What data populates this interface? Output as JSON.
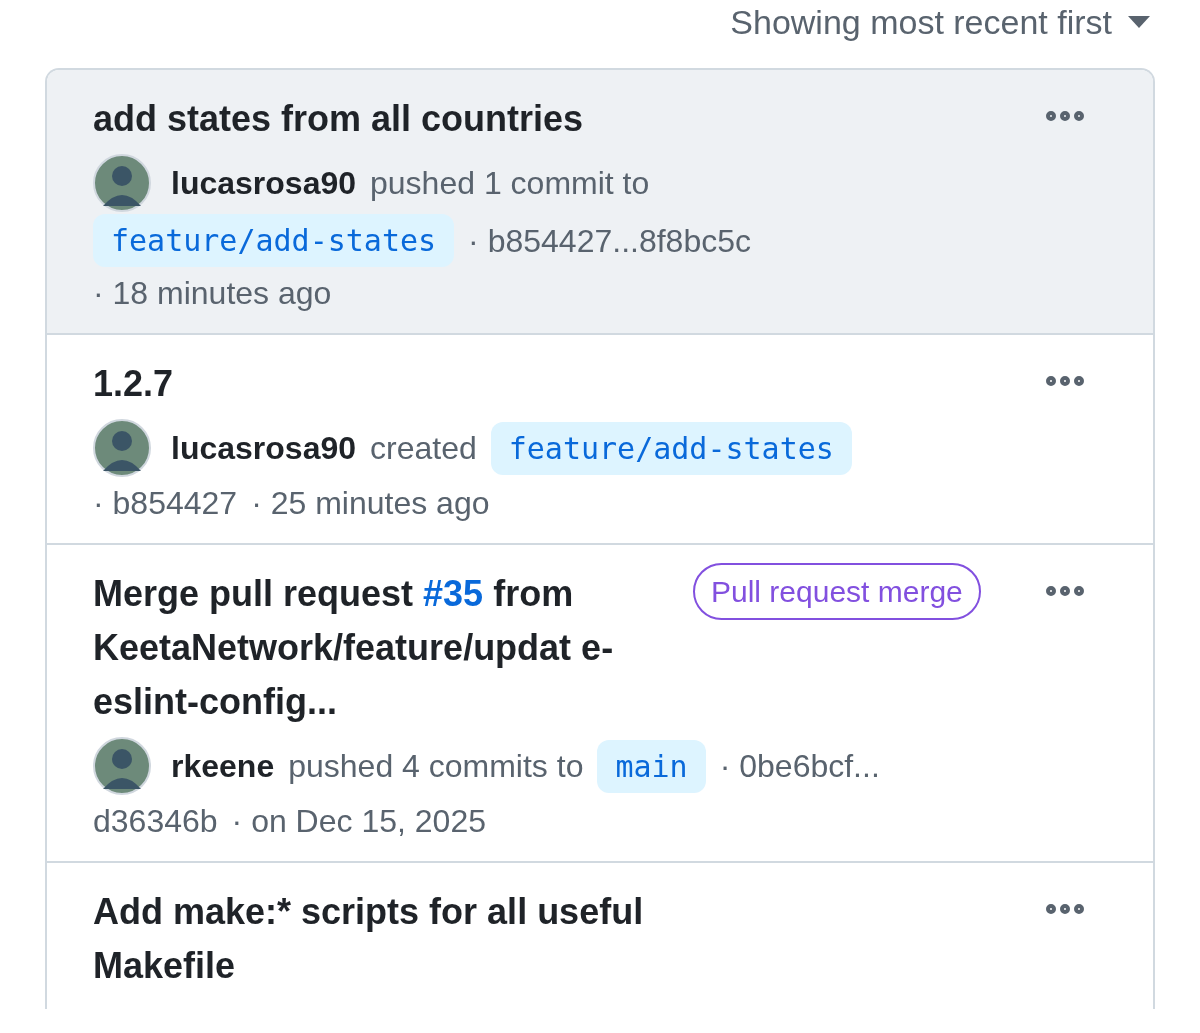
{
  "sort": {
    "label": "Showing most recent first"
  },
  "events": [
    {
      "highlighted": true,
      "title": [
        {
          "kind": "text",
          "text": "add states from all countries"
        }
      ],
      "meta": [
        {
          "kind": "user",
          "text": "lucasrosa90"
        },
        {
          "kind": "text",
          "text": "pushed 1 commit to"
        },
        {
          "kind": "branch",
          "text": "feature/add-states"
        },
        {
          "kind": "text",
          "text": "· b854427...8f8bc5c"
        },
        {
          "kind": "text",
          "text": "· 18 minutes ago"
        }
      ]
    },
    {
      "highlighted": false,
      "title": [
        {
          "kind": "text",
          "text": "1.2.7"
        }
      ],
      "meta": [
        {
          "kind": "user",
          "text": "lucasrosa90"
        },
        {
          "kind": "text",
          "text": "created"
        },
        {
          "kind": "branch",
          "text": "feature/add-states"
        },
        {
          "kind": "text",
          "text": "· b854427"
        },
        {
          "kind": "text",
          "text": "· 25 minutes ago"
        }
      ]
    },
    {
      "highlighted": false,
      "badge": "Pull request merge",
      "title": [
        {
          "kind": "text",
          "text": "Merge pull request "
        },
        {
          "kind": "link",
          "text": "#35"
        },
        {
          "kind": "text",
          "text": " from KeetaNetwork/feature/updat e-eslint-config..."
        }
      ],
      "meta": [
        {
          "kind": "user",
          "text": "rkeene"
        },
        {
          "kind": "text",
          "text": "pushed 4 commits to"
        },
        {
          "kind": "branch",
          "text": "main"
        },
        {
          "kind": "text",
          "text": "· 0be6bcf..."
        },
        {
          "kind": "text",
          "text": "d36346b"
        },
        {
          "kind": "text",
          "text": "· on Dec 15, 2025"
        }
      ]
    },
    {
      "highlighted": false,
      "title": [
        {
          "kind": "text",
          "text": "Add make:* scripts for all useful Makefile"
        }
      ]
    }
  ]
}
